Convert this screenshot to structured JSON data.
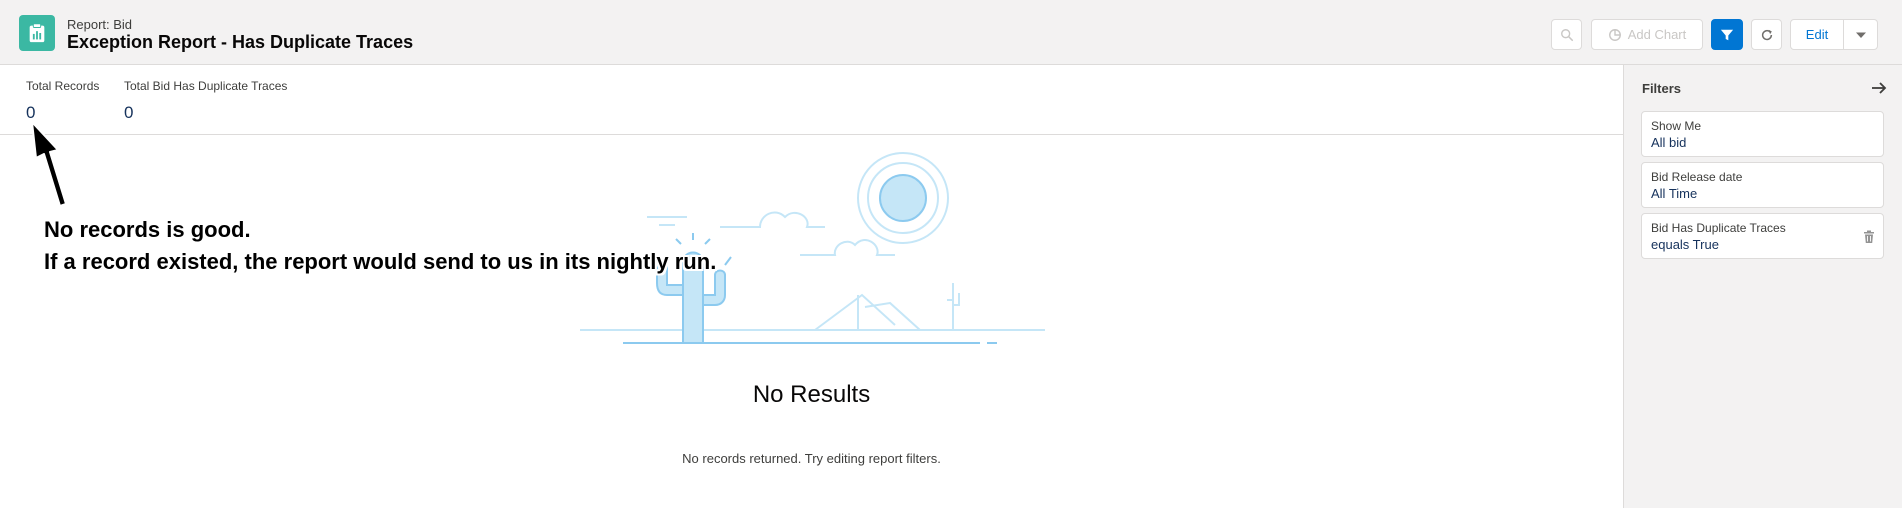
{
  "header": {
    "report_type": "Report: Bid",
    "report_title": "Exception Report - Has Duplicate Traces",
    "icon": "report-icon"
  },
  "toolbar": {
    "search_icon": "search-icon",
    "add_chart_label": "Add Chart",
    "filter_icon": "filter-icon",
    "refresh_icon": "refresh-icon",
    "edit_label": "Edit",
    "more_icon": "chevron-down-icon"
  },
  "summary": [
    {
      "label": "Total Records",
      "value": "0"
    },
    {
      "label": "Total Bid Has Duplicate Traces",
      "value": "0"
    }
  ],
  "annotation": {
    "line1": "No records is good.",
    "line2": "If a record existed, the report would send to us in its nightly run."
  },
  "empty_state": {
    "title": "No Results",
    "message": "No records returned. Try editing report filters."
  },
  "filters": {
    "title": "Filters",
    "items": [
      {
        "label": "Show Me",
        "value": "All bid"
      },
      {
        "label": "Bid Release date",
        "value": "All Time"
      },
      {
        "label": "Bid Has Duplicate Traces",
        "value": "equals True"
      }
    ]
  },
  "colors": {
    "brand_blue": "#0176d3",
    "report_icon_bg": "#3bb8a3",
    "illustration_blue": "#c5e6f7"
  }
}
